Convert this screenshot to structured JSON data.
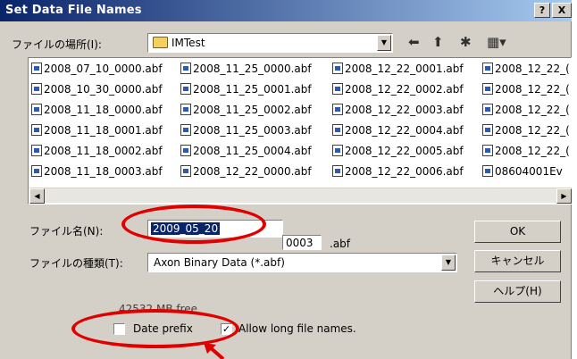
{
  "window": {
    "title": "Set Data File Names",
    "help_btn": "?",
    "close_btn": "X"
  },
  "location": {
    "label": "ファイルの場所(I):",
    "value": "IMTest"
  },
  "files": [
    [
      "2008_07_10_0000.abf",
      "2008_11_25_0000.abf",
      "2008_12_22_0001.abf",
      "2008_12_22_("
    ],
    [
      "2008_10_30_0000.abf",
      "2008_11_25_0001.abf",
      "2008_12_22_0002.abf",
      "2008_12_22_("
    ],
    [
      "2008_11_18_0000.abf",
      "2008_11_25_0002.abf",
      "2008_12_22_0003.abf",
      "2008_12_22_("
    ],
    [
      "2008_11_18_0001.abf",
      "2008_11_25_0003.abf",
      "2008_12_22_0004.abf",
      "2008_12_22_("
    ],
    [
      "2008_11_18_0002.abf",
      "2008_11_25_0004.abf",
      "2008_12_22_0005.abf",
      "2008_12_22_("
    ],
    [
      "2008_11_18_0003.abf",
      "2008_12_22_0000.abf",
      "2008_12_22_0006.abf",
      "08604001Ev"
    ]
  ],
  "filename": {
    "label": "ファイル名(N):",
    "value": "2009_05_20",
    "counter": "0003",
    "ext": ".abf"
  },
  "filetype": {
    "label": "ファイルの種類(T):",
    "value": "Axon Binary Data (*.abf)"
  },
  "buttons": {
    "ok": "OK",
    "cancel": "キャンセル",
    "help": "ヘルプ(H)"
  },
  "free_space": "42532 MB free",
  "date_prefix": {
    "label": "Date prefix",
    "checked": false
  },
  "long_names": {
    "label": "Allow long file names.",
    "checked": true
  },
  "annotation_color": "#e00000"
}
